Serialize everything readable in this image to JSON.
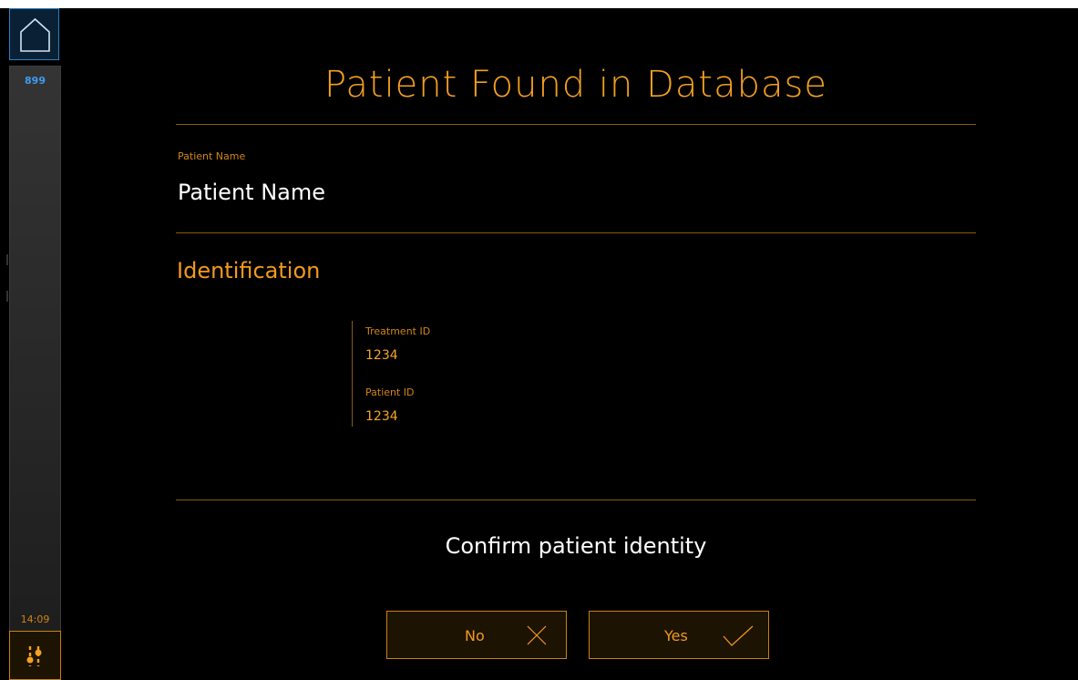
{
  "sidebar": {
    "home_icon": "home-icon",
    "count": "899",
    "clock": "14:09",
    "settings_icon": "sliders-icon"
  },
  "page": {
    "title": "Patient Found in Database"
  },
  "patient": {
    "name_label": "Patient Name",
    "name_value": "Patient Name"
  },
  "identification": {
    "title": "Identification",
    "treatment_id_label": "Treatment ID",
    "treatment_id_value": "1234",
    "patient_id_label": "Patient ID",
    "patient_id_value": "1234"
  },
  "confirm": {
    "prompt": "Confirm patient identity",
    "no_label": "No",
    "no_icon": "close-icon",
    "yes_label": "Yes",
    "yes_icon": "checkmark-icon"
  },
  "colors": {
    "accent": "#f39a1d",
    "divider": "#8a5a12",
    "info_blue": "#3e9bf1",
    "background": "#000000"
  }
}
